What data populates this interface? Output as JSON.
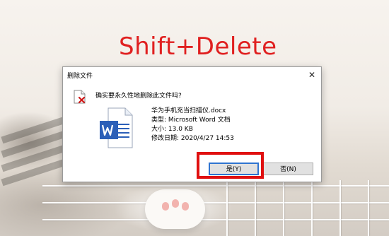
{
  "overlay": {
    "shortcut_text": "Shift+Delete"
  },
  "dialog": {
    "title": "删除文件",
    "close_glyph": "✕",
    "question": "确实要永久性地删除此文件吗?",
    "file": {
      "name": "华为手机充当扫描仪.docx",
      "type_line": "类型: Microsoft Word 文档",
      "size_line": "大小: 13.0 KB",
      "modified_line": "修改日期: 2020/4/27 14:53"
    },
    "buttons": {
      "yes_label": "是(Y)",
      "no_label": "否(N)"
    }
  },
  "icons": {
    "warning": "delete-warning-icon",
    "word": "word-document-icon",
    "close": "close-icon"
  },
  "colors": {
    "highlight": "#e01010",
    "overlay_text": "#e02020",
    "word_blue": "#2b5fb8",
    "focus_blue": "#2f74d0"
  }
}
